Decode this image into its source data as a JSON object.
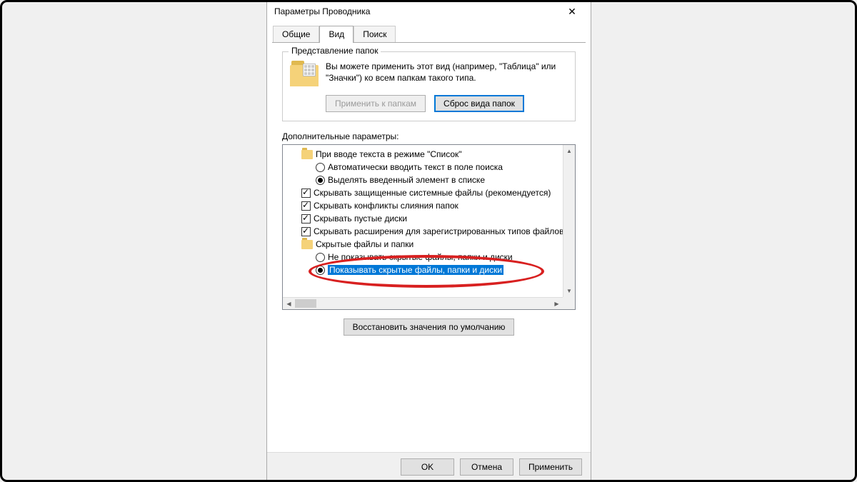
{
  "window": {
    "title": "Параметры Проводника"
  },
  "tabs": {
    "general": "Общие",
    "view": "Вид",
    "search": "Поиск"
  },
  "folder_views": {
    "group_title": "Представление папок",
    "description": "Вы можете применить этот вид (например, \"Таблица\" или \"Значки\") ко всем папкам такого типа.",
    "apply_btn": "Применить к папкам",
    "reset_btn": "Сброс вида папок"
  },
  "advanced": {
    "label": "Дополнительные параметры:",
    "items": {
      "group_list_mode": "При вводе текста в режиме \"Список\"",
      "opt_search_auto": "Автоматически вводить текст в поле поиска",
      "opt_select_typed": "Выделять введенный элемент в списке",
      "chk_hide_protected": "Скрывать защищенные системные файлы (рекомендуется)",
      "chk_hide_merge": "Скрывать конфликты слияния папок",
      "chk_hide_empty": "Скрывать пустые диски",
      "chk_hide_ext": "Скрывать расширения для зарегистрированных типов файлов",
      "group_hidden": "Скрытые файлы и папки",
      "opt_dont_show": "Не показывать скрытые файлы, папки и диски",
      "opt_show_hidden": "Показывать скрытые файлы, папки и диски"
    }
  },
  "restore_defaults": "Восстановить значения по умолчанию",
  "buttons": {
    "ok": "OK",
    "cancel": "Отмена",
    "apply": "Применить"
  }
}
